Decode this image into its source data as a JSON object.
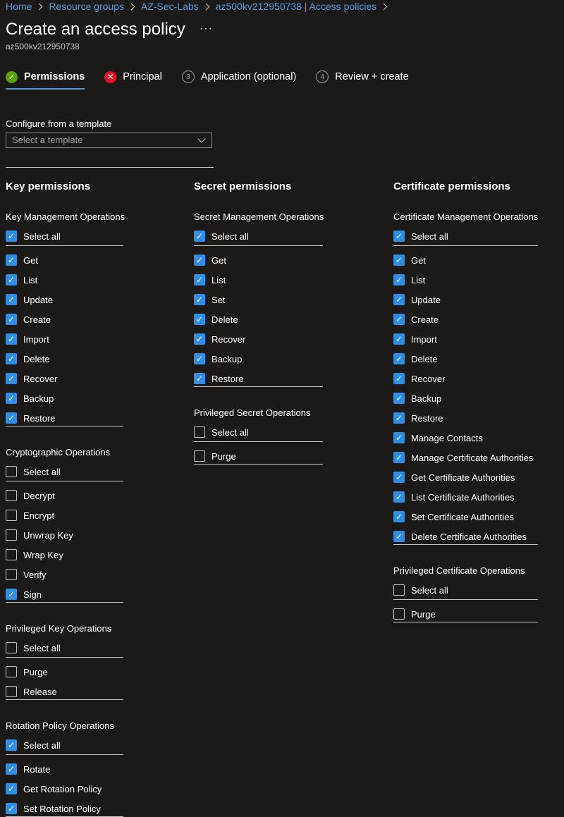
{
  "breadcrumb": [
    "Home",
    "Resource groups",
    "AZ-Sec-Labs",
    "az500kv212950738 | Access policies"
  ],
  "page": {
    "title": "Create an access policy",
    "more": "···",
    "subtitle": "az500kv212950738"
  },
  "tabs": [
    {
      "label": "Permissions",
      "state": "done",
      "num": ""
    },
    {
      "label": "Principal",
      "state": "error",
      "num": ""
    },
    {
      "label": "Application (optional)",
      "state": "pending",
      "num": "3"
    },
    {
      "label": "Review + create",
      "state": "pending",
      "num": "4"
    }
  ],
  "template": {
    "label": "Configure from a template",
    "placeholder": "Select a template"
  },
  "columns": [
    {
      "title": "Key permissions",
      "groups": [
        {
          "title": "Key Management Operations",
          "select_all": {
            "label": "Select all",
            "checked": true
          },
          "items": [
            {
              "label": "Get",
              "checked": true
            },
            {
              "label": "List",
              "checked": true
            },
            {
              "label": "Update",
              "checked": true
            },
            {
              "label": "Create",
              "checked": true
            },
            {
              "label": "Import",
              "checked": true
            },
            {
              "label": "Delete",
              "checked": true
            },
            {
              "label": "Recover",
              "checked": true
            },
            {
              "label": "Backup",
              "checked": true
            },
            {
              "label": "Restore",
              "checked": true
            }
          ]
        },
        {
          "title": "Cryptographic Operations",
          "select_all": {
            "label": "Select all",
            "checked": false
          },
          "items": [
            {
              "label": "Decrypt",
              "checked": false
            },
            {
              "label": "Encrypt",
              "checked": false
            },
            {
              "label": "Unwrap Key",
              "checked": false
            },
            {
              "label": "Wrap Key",
              "checked": false
            },
            {
              "label": "Verify",
              "checked": false
            },
            {
              "label": "Sign",
              "checked": true
            }
          ]
        },
        {
          "title": "Privileged Key Operations",
          "select_all": {
            "label": "Select all",
            "checked": false
          },
          "items": [
            {
              "label": "Purge",
              "checked": false
            },
            {
              "label": "Release",
              "checked": false
            }
          ]
        },
        {
          "title": "Rotation Policy Operations",
          "select_all": {
            "label": "Select all",
            "checked": true
          },
          "items": [
            {
              "label": "Rotate",
              "checked": true
            },
            {
              "label": "Get Rotation Policy",
              "checked": true
            },
            {
              "label": "Set Rotation Policy",
              "checked": true
            }
          ]
        }
      ]
    },
    {
      "title": "Secret permissions",
      "groups": [
        {
          "title": "Secret Management Operations",
          "select_all": {
            "label": "Select all",
            "checked": true
          },
          "items": [
            {
              "label": "Get",
              "checked": true
            },
            {
              "label": "List",
              "checked": true
            },
            {
              "label": "Set",
              "checked": true
            },
            {
              "label": "Delete",
              "checked": true
            },
            {
              "label": "Recover",
              "checked": true
            },
            {
              "label": "Backup",
              "checked": true
            },
            {
              "label": "Restore",
              "checked": true
            }
          ]
        },
        {
          "title": "Privileged Secret Operations",
          "select_all": {
            "label": "Select all",
            "checked": false
          },
          "items": [
            {
              "label": "Purge",
              "checked": false
            }
          ]
        }
      ]
    },
    {
      "title": "Certificate permissions",
      "groups": [
        {
          "title": "Certificate Management Operations",
          "select_all": {
            "label": "Select all",
            "checked": true
          },
          "items": [
            {
              "label": "Get",
              "checked": true
            },
            {
              "label": "List",
              "checked": true
            },
            {
              "label": "Update",
              "checked": true
            },
            {
              "label": "Create",
              "checked": true
            },
            {
              "label": "Import",
              "checked": true
            },
            {
              "label": "Delete",
              "checked": true
            },
            {
              "label": "Recover",
              "checked": true
            },
            {
              "label": "Backup",
              "checked": true
            },
            {
              "label": "Restore",
              "checked": true
            },
            {
              "label": "Manage Contacts",
              "checked": true
            },
            {
              "label": "Manage Certificate Authorities",
              "checked": true
            },
            {
              "label": "Get Certificate Authorities",
              "checked": true
            },
            {
              "label": "List Certificate Authorities",
              "checked": true
            },
            {
              "label": "Set Certificate Authorities",
              "checked": true
            },
            {
              "label": "Delete Certificate Authorities",
              "checked": true
            }
          ]
        },
        {
          "title": "Privileged Certificate Operations",
          "select_all": {
            "label": "Select all",
            "checked": false
          },
          "items": [
            {
              "label": "Purge",
              "checked": false
            }
          ]
        }
      ]
    }
  ]
}
